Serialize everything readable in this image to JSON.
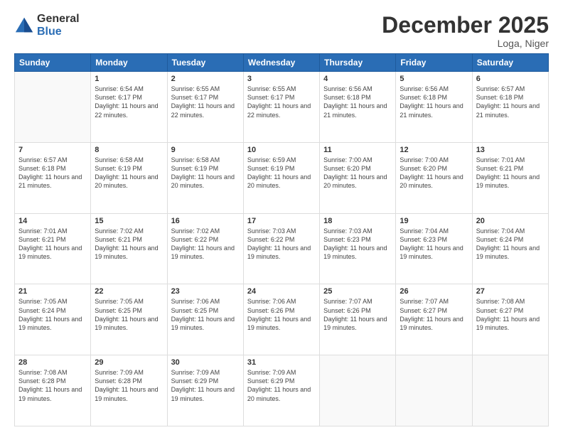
{
  "header": {
    "logo_general": "General",
    "logo_blue": "Blue",
    "month_title": "December 2025",
    "location": "Loga, Niger"
  },
  "days_of_week": [
    "Sunday",
    "Monday",
    "Tuesday",
    "Wednesday",
    "Thursday",
    "Friday",
    "Saturday"
  ],
  "weeks": [
    [
      {
        "day": "",
        "sunrise": "",
        "sunset": "",
        "daylight": ""
      },
      {
        "day": "1",
        "sunrise": "Sunrise: 6:54 AM",
        "sunset": "Sunset: 6:17 PM",
        "daylight": "Daylight: 11 hours and 22 minutes."
      },
      {
        "day": "2",
        "sunrise": "Sunrise: 6:55 AM",
        "sunset": "Sunset: 6:17 PM",
        "daylight": "Daylight: 11 hours and 22 minutes."
      },
      {
        "day": "3",
        "sunrise": "Sunrise: 6:55 AM",
        "sunset": "Sunset: 6:17 PM",
        "daylight": "Daylight: 11 hours and 22 minutes."
      },
      {
        "day": "4",
        "sunrise": "Sunrise: 6:56 AM",
        "sunset": "Sunset: 6:18 PM",
        "daylight": "Daylight: 11 hours and 21 minutes."
      },
      {
        "day": "5",
        "sunrise": "Sunrise: 6:56 AM",
        "sunset": "Sunset: 6:18 PM",
        "daylight": "Daylight: 11 hours and 21 minutes."
      },
      {
        "day": "6",
        "sunrise": "Sunrise: 6:57 AM",
        "sunset": "Sunset: 6:18 PM",
        "daylight": "Daylight: 11 hours and 21 minutes."
      }
    ],
    [
      {
        "day": "7",
        "sunrise": "Sunrise: 6:57 AM",
        "sunset": "Sunset: 6:18 PM",
        "daylight": "Daylight: 11 hours and 21 minutes."
      },
      {
        "day": "8",
        "sunrise": "Sunrise: 6:58 AM",
        "sunset": "Sunset: 6:19 PM",
        "daylight": "Daylight: 11 hours and 20 minutes."
      },
      {
        "day": "9",
        "sunrise": "Sunrise: 6:58 AM",
        "sunset": "Sunset: 6:19 PM",
        "daylight": "Daylight: 11 hours and 20 minutes."
      },
      {
        "day": "10",
        "sunrise": "Sunrise: 6:59 AM",
        "sunset": "Sunset: 6:19 PM",
        "daylight": "Daylight: 11 hours and 20 minutes."
      },
      {
        "day": "11",
        "sunrise": "Sunrise: 7:00 AM",
        "sunset": "Sunset: 6:20 PM",
        "daylight": "Daylight: 11 hours and 20 minutes."
      },
      {
        "day": "12",
        "sunrise": "Sunrise: 7:00 AM",
        "sunset": "Sunset: 6:20 PM",
        "daylight": "Daylight: 11 hours and 20 minutes."
      },
      {
        "day": "13",
        "sunrise": "Sunrise: 7:01 AM",
        "sunset": "Sunset: 6:21 PM",
        "daylight": "Daylight: 11 hours and 19 minutes."
      }
    ],
    [
      {
        "day": "14",
        "sunrise": "Sunrise: 7:01 AM",
        "sunset": "Sunset: 6:21 PM",
        "daylight": "Daylight: 11 hours and 19 minutes."
      },
      {
        "day": "15",
        "sunrise": "Sunrise: 7:02 AM",
        "sunset": "Sunset: 6:21 PM",
        "daylight": "Daylight: 11 hours and 19 minutes."
      },
      {
        "day": "16",
        "sunrise": "Sunrise: 7:02 AM",
        "sunset": "Sunset: 6:22 PM",
        "daylight": "Daylight: 11 hours and 19 minutes."
      },
      {
        "day": "17",
        "sunrise": "Sunrise: 7:03 AM",
        "sunset": "Sunset: 6:22 PM",
        "daylight": "Daylight: 11 hours and 19 minutes."
      },
      {
        "day": "18",
        "sunrise": "Sunrise: 7:03 AM",
        "sunset": "Sunset: 6:23 PM",
        "daylight": "Daylight: 11 hours and 19 minutes."
      },
      {
        "day": "19",
        "sunrise": "Sunrise: 7:04 AM",
        "sunset": "Sunset: 6:23 PM",
        "daylight": "Daylight: 11 hours and 19 minutes."
      },
      {
        "day": "20",
        "sunrise": "Sunrise: 7:04 AM",
        "sunset": "Sunset: 6:24 PM",
        "daylight": "Daylight: 11 hours and 19 minutes."
      }
    ],
    [
      {
        "day": "21",
        "sunrise": "Sunrise: 7:05 AM",
        "sunset": "Sunset: 6:24 PM",
        "daylight": "Daylight: 11 hours and 19 minutes."
      },
      {
        "day": "22",
        "sunrise": "Sunrise: 7:05 AM",
        "sunset": "Sunset: 6:25 PM",
        "daylight": "Daylight: 11 hours and 19 minutes."
      },
      {
        "day": "23",
        "sunrise": "Sunrise: 7:06 AM",
        "sunset": "Sunset: 6:25 PM",
        "daylight": "Daylight: 11 hours and 19 minutes."
      },
      {
        "day": "24",
        "sunrise": "Sunrise: 7:06 AM",
        "sunset": "Sunset: 6:26 PM",
        "daylight": "Daylight: 11 hours and 19 minutes."
      },
      {
        "day": "25",
        "sunrise": "Sunrise: 7:07 AM",
        "sunset": "Sunset: 6:26 PM",
        "daylight": "Daylight: 11 hours and 19 minutes."
      },
      {
        "day": "26",
        "sunrise": "Sunrise: 7:07 AM",
        "sunset": "Sunset: 6:27 PM",
        "daylight": "Daylight: 11 hours and 19 minutes."
      },
      {
        "day": "27",
        "sunrise": "Sunrise: 7:08 AM",
        "sunset": "Sunset: 6:27 PM",
        "daylight": "Daylight: 11 hours and 19 minutes."
      }
    ],
    [
      {
        "day": "28",
        "sunrise": "Sunrise: 7:08 AM",
        "sunset": "Sunset: 6:28 PM",
        "daylight": "Daylight: 11 hours and 19 minutes."
      },
      {
        "day": "29",
        "sunrise": "Sunrise: 7:09 AM",
        "sunset": "Sunset: 6:28 PM",
        "daylight": "Daylight: 11 hours and 19 minutes."
      },
      {
        "day": "30",
        "sunrise": "Sunrise: 7:09 AM",
        "sunset": "Sunset: 6:29 PM",
        "daylight": "Daylight: 11 hours and 19 minutes."
      },
      {
        "day": "31",
        "sunrise": "Sunrise: 7:09 AM",
        "sunset": "Sunset: 6:29 PM",
        "daylight": "Daylight: 11 hours and 20 minutes."
      },
      {
        "day": "",
        "sunrise": "",
        "sunset": "",
        "daylight": ""
      },
      {
        "day": "",
        "sunrise": "",
        "sunset": "",
        "daylight": ""
      },
      {
        "day": "",
        "sunrise": "",
        "sunset": "",
        "daylight": ""
      }
    ]
  ]
}
